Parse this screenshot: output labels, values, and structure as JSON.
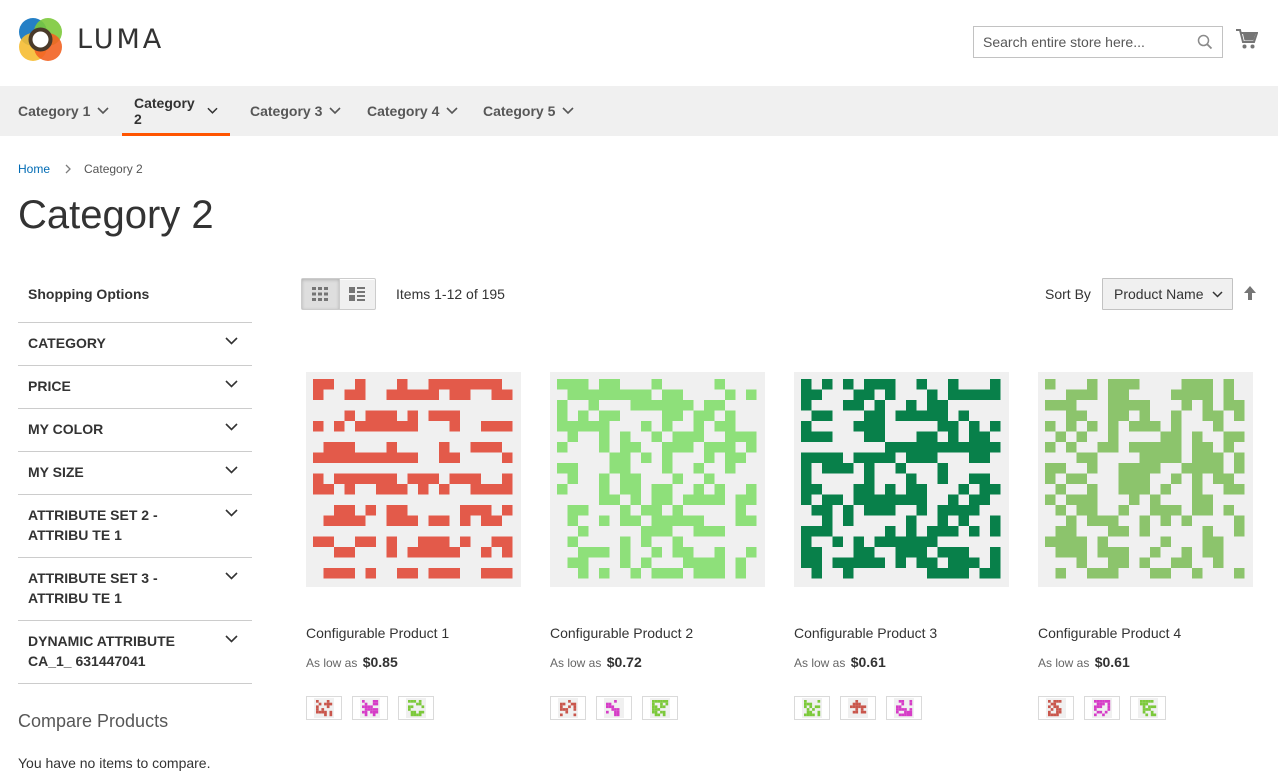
{
  "header": {
    "logo_text": "LUMA",
    "search_placeholder": "Search entire store here..."
  },
  "nav": {
    "items": [
      {
        "label": "Category 1"
      },
      {
        "label": "Category 2"
      },
      {
        "label": "Category 3"
      },
      {
        "label": "Category 4"
      },
      {
        "label": "Category 5"
      }
    ],
    "active_index": 1
  },
  "breadcrumb": {
    "home": "Home",
    "current": "Category 2"
  },
  "page_title": "Category 2",
  "sidebar": {
    "title": "Shopping Options",
    "filters": [
      {
        "label": "CATEGORY"
      },
      {
        "label": "PRICE"
      },
      {
        "label": "MY COLOR"
      },
      {
        "label": "MY SIZE"
      },
      {
        "label": "ATTRIBUTE SET 2 - ATTRIBU TE 1"
      },
      {
        "label": "ATTRIBUTE SET 3 - ATTRIBU TE 1"
      },
      {
        "label": "DYNAMIC ATTRIBUTE CA_1_ 631447041"
      }
    ],
    "compare_title": "Compare Products",
    "compare_empty": "You have no items to compare."
  },
  "toolbar": {
    "items_count": "Items 1-12 of 195",
    "sort_label": "Sort By",
    "sort_value": "Product Name"
  },
  "products": [
    {
      "name": "Configurable Product 1",
      "price_prefix": "As low as",
      "price": "$0.85",
      "color": "#e35a4a",
      "swatch_colors": [
        "#c9564c",
        "#d63cc7",
        "#7cc93b"
      ]
    },
    {
      "name": "Configurable Product 2",
      "price_prefix": "As low as",
      "price": "$0.72",
      "color": "#8ee07a",
      "swatch_colors": [
        "#c9564c",
        "#d63cc7",
        "#7cc93b"
      ]
    },
    {
      "name": "Configurable Product 3",
      "price_prefix": "As low as",
      "price": "$0.61",
      "color": "#08804a",
      "swatch_colors": [
        "#7cc93b",
        "#c9564c",
        "#d63cc7"
      ]
    },
    {
      "name": "Configurable Product 4",
      "price_prefix": "As low as",
      "price": "$0.61",
      "color": "#8cc46c",
      "swatch_colors": [
        "#c9564c",
        "#d63cc7",
        "#7cc93b"
      ]
    }
  ],
  "icons": {
    "search": "search-icon",
    "cart": "cart-icon",
    "grid": "grid-icon",
    "list": "list-icon",
    "sort_direction": "arrow-up-icon"
  },
  "colors": {
    "accent": "#ff5501",
    "link": "#006bb4",
    "nav_bg": "#f0f0f0"
  }
}
